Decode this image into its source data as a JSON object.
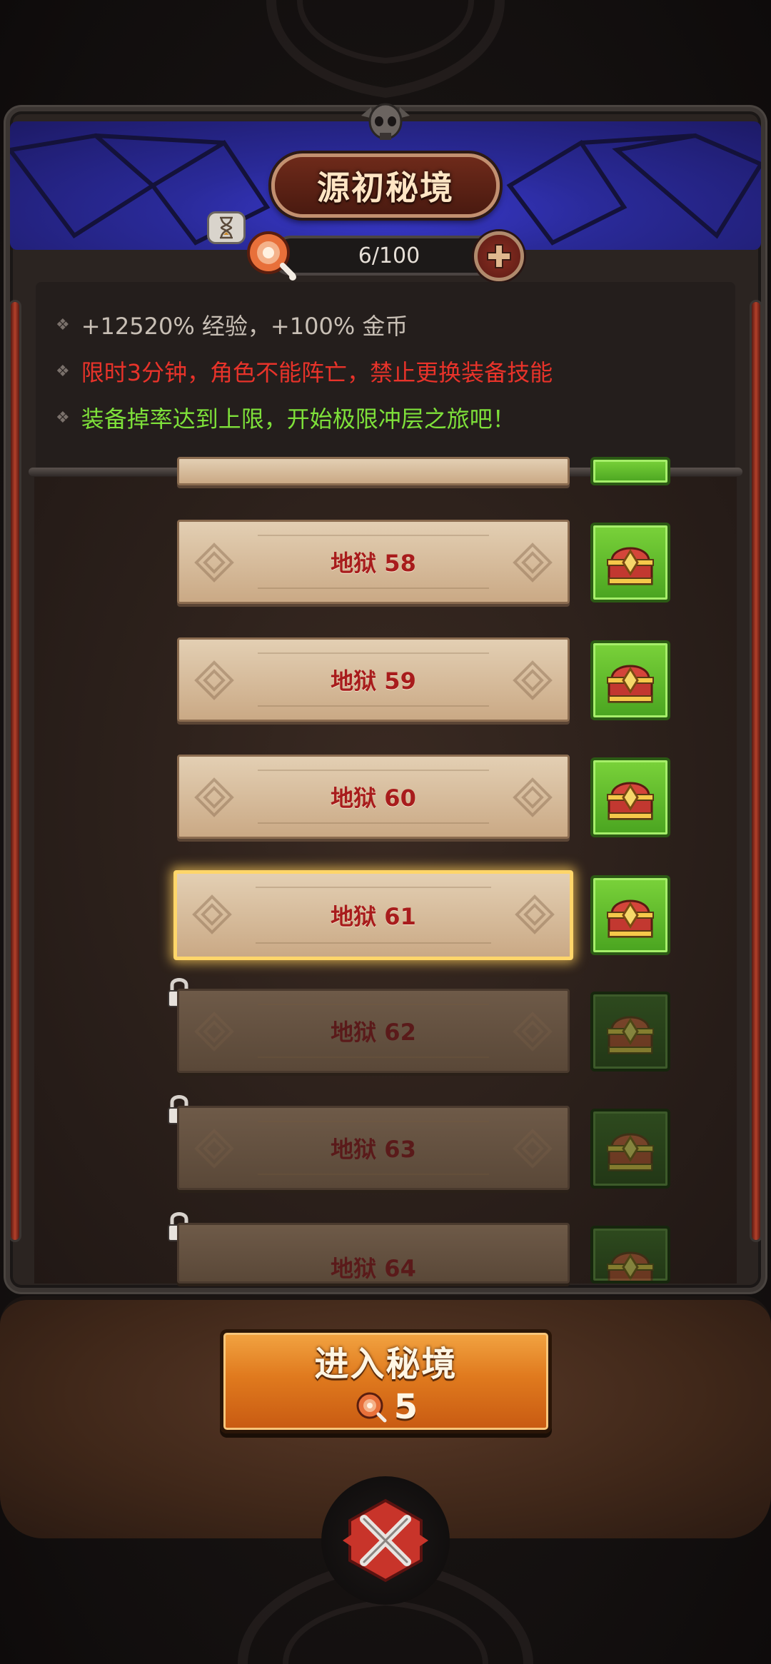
{
  "header": {
    "title": "源初秘境",
    "stamina": "6/100"
  },
  "info": {
    "line1": "+12520% 经验，+100% 金币",
    "line2": "限时3分钟，角色不能阵亡，禁止更换装备技能",
    "line3": "装备掉率达到上限，开始极限冲层之旅吧！"
  },
  "levels": [
    {
      "label": "地狱 58",
      "state": "unlocked"
    },
    {
      "label": "地狱 59",
      "state": "unlocked"
    },
    {
      "label": "地狱 60",
      "state": "unlocked"
    },
    {
      "label": "地狱 61",
      "state": "selected"
    },
    {
      "label": "地狱 62",
      "state": "locked"
    },
    {
      "label": "地狱 63",
      "state": "locked"
    },
    {
      "label": "地狱 64",
      "state": "locked"
    }
  ],
  "enter_button": {
    "label": "进入秘境",
    "cost": "5"
  },
  "colors": {
    "exp_text": "#c8bfb5",
    "warning_text": "#e8332a",
    "bonus_text": "#7ee03a",
    "level_label": "#a81c1c",
    "chest_green": "#6ad02e",
    "button_orange": "#e07a1e"
  },
  "icons": [
    "skull-icon",
    "hourglass-icon",
    "meat-icon",
    "plus-icon",
    "chest-icon",
    "lock-icon",
    "close-icon"
  ]
}
